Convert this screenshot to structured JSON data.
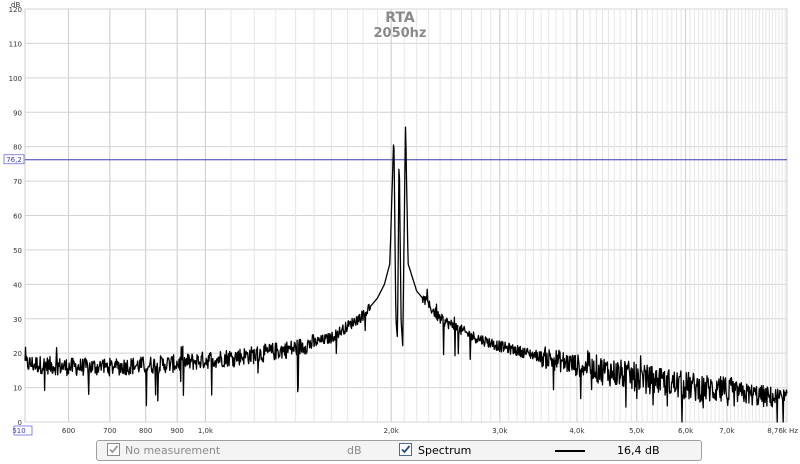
{
  "chart_data": {
    "type": "line",
    "title": "RTA",
    "subtitle": "2050hz",
    "ylabel": "dB",
    "xunit": "Hz",
    "xscale": "log",
    "xlim": [
      510,
      8760
    ],
    "ylim": [
      0,
      120
    ],
    "yticks": [
      0,
      10,
      20,
      30,
      40,
      50,
      60,
      70,
      80,
      90,
      100,
      110,
      120
    ],
    "xticks": [
      {
        "value": 510,
        "label": "510"
      },
      {
        "value": 600,
        "label": "600"
      },
      {
        "value": 700,
        "label": "700"
      },
      {
        "value": 800,
        "label": "800"
      },
      {
        "value": 900,
        "label": "900"
      },
      {
        "value": 1000,
        "label": "1,0k"
      },
      {
        "value": 2000,
        "label": "2,0k"
      },
      {
        "value": 3000,
        "label": "3,0k"
      },
      {
        "value": 4000,
        "label": "4,0k"
      },
      {
        "value": 5000,
        "label": "5,0k"
      },
      {
        "value": 6000,
        "label": "6,0k"
      },
      {
        "value": 7000,
        "label": "7,0k"
      },
      {
        "value": 8760,
        "label": "8,76k Hz"
      }
    ],
    "reference_line": {
      "value": 76.2,
      "label": "76,2",
      "color": "#3c3cb4"
    },
    "grid": true,
    "series": [
      {
        "name": "Spectrum",
        "color": "#000000",
        "points": [
          [
            510,
            17
          ],
          [
            600,
            16
          ],
          [
            700,
            16
          ],
          [
            800,
            16.5
          ],
          [
            900,
            17
          ],
          [
            1000,
            18
          ],
          [
            1200,
            19.5
          ],
          [
            1400,
            21.5
          ],
          [
            1600,
            24.5
          ],
          [
            1800,
            31
          ],
          [
            1900,
            36
          ],
          [
            1950,
            40
          ],
          [
            1990,
            46
          ],
          [
            2020,
            84
          ],
          [
            2035,
            30
          ],
          [
            2048,
            24
          ],
          [
            2060,
            80
          ],
          [
            2075,
            30
          ],
          [
            2088,
            22
          ],
          [
            2110,
            87.5
          ],
          [
            2130,
            46
          ],
          [
            2200,
            38
          ],
          [
            2400,
            30
          ],
          [
            2700,
            25
          ],
          [
            3000,
            22
          ],
          [
            3500,
            19
          ],
          [
            4000,
            16.5
          ],
          [
            5000,
            13
          ],
          [
            6000,
            10.5
          ],
          [
            7000,
            9
          ],
          [
            8000,
            7.5
          ],
          [
            8760,
            6.5
          ]
        ]
      }
    ]
  },
  "legend": {
    "no_measurement": "No measurement",
    "no_measurement_checked": true,
    "units": "dB",
    "spectrum": "Spectrum",
    "spectrum_checked": true,
    "line_color": "#000000",
    "value": "16,4 dB"
  }
}
